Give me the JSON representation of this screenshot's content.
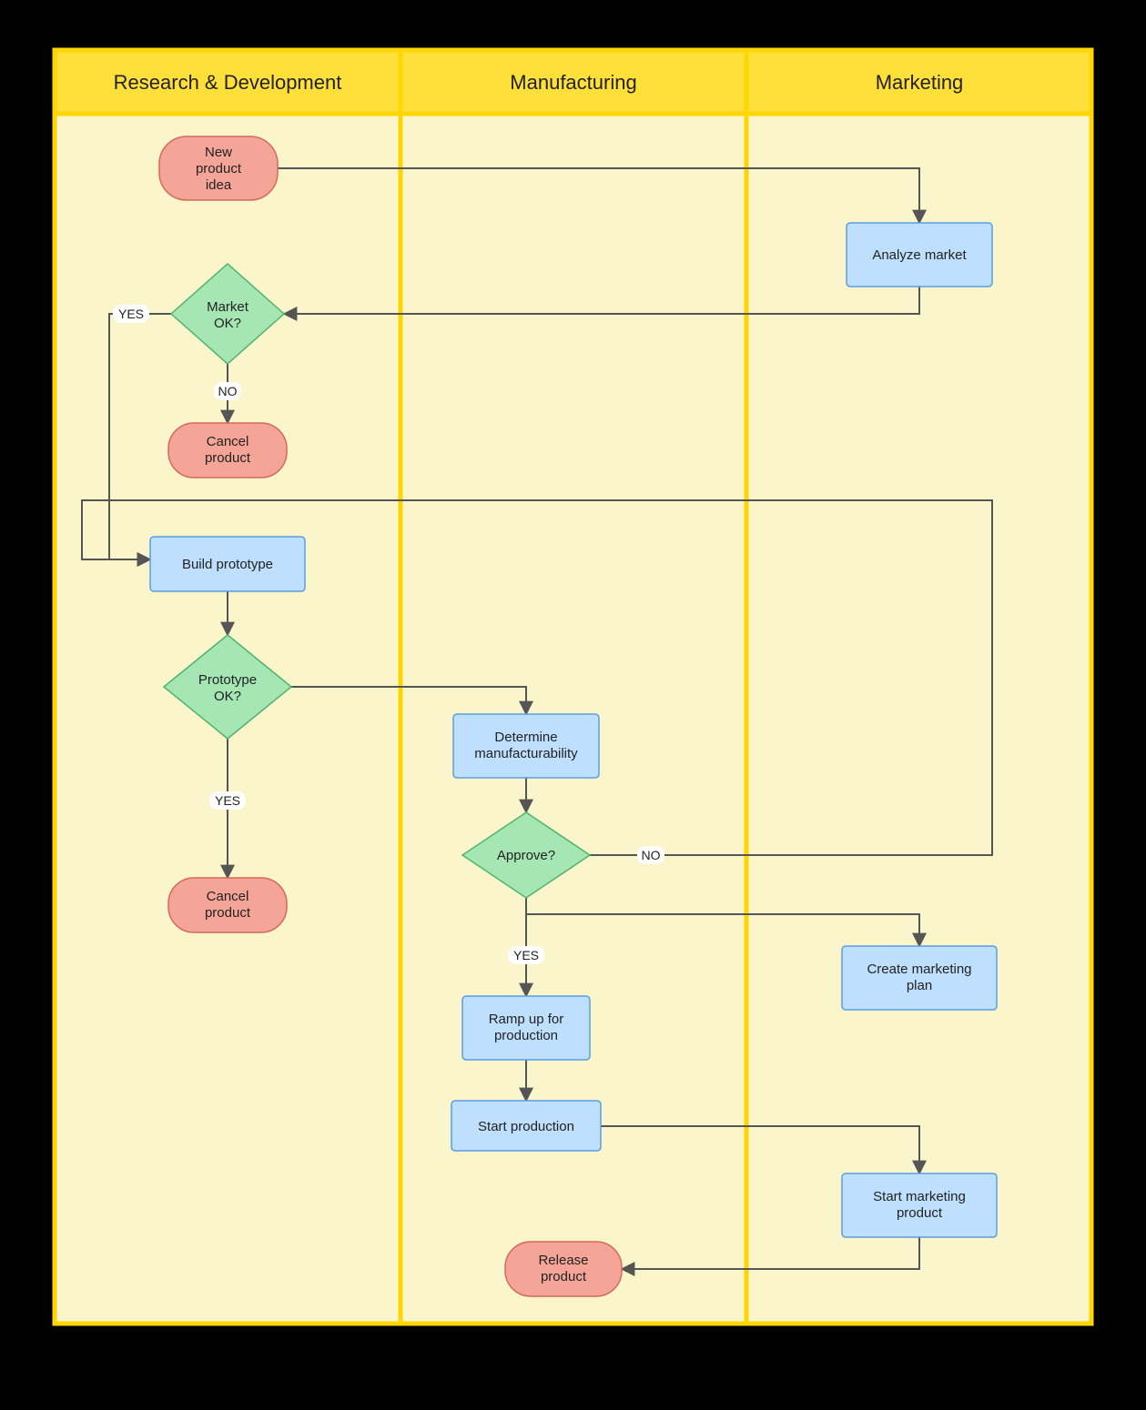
{
  "lanes": {
    "rd": {
      "title": "Research & Development"
    },
    "mfg": {
      "title": "Manufacturing"
    },
    "mkt": {
      "title": "Marketing"
    }
  },
  "nodes": {
    "new_idea": {
      "label1": "New",
      "label2": "product",
      "label3": "idea"
    },
    "analyze_market": {
      "label": "Analyze market"
    },
    "market_ok": {
      "label1": "Market",
      "label2": "OK?"
    },
    "cancel1": {
      "label1": "Cancel",
      "label2": "product"
    },
    "build_proto": {
      "label": "Build prototype"
    },
    "proto_ok": {
      "label1": "Prototype",
      "label2": "OK?"
    },
    "cancel2": {
      "label1": "Cancel",
      "label2": "product"
    },
    "determine_mfg": {
      "label1": "Determine",
      "label2": "manufacturability"
    },
    "approve": {
      "label": "Approve?"
    },
    "marketing_plan": {
      "label1": "Create marketing",
      "label2": "plan"
    },
    "ramp_up": {
      "label1": "Ramp up for",
      "label2": "production"
    },
    "start_prod": {
      "label": "Start production"
    },
    "start_mkt": {
      "label1": "Start marketing",
      "label2": "product"
    },
    "release": {
      "label1": "Release",
      "label2": "product"
    }
  },
  "edge_labels": {
    "market_yes": "YES",
    "market_no": "NO",
    "proto_yes": "YES",
    "approve_no": "NO",
    "approve_yes": "YES"
  },
  "colors": {
    "lane_header": "#ffe03a",
    "lane_body": "#fbf5cb",
    "lane_border": "#ffd600",
    "terminator_fill": "#f5a597",
    "terminator_stroke": "#d46a5c",
    "process_fill": "#bedffe",
    "process_stroke": "#5a9de4",
    "decision_fill": "#a5e6b4",
    "decision_stroke": "#4fb36a",
    "edge": "#555"
  }
}
